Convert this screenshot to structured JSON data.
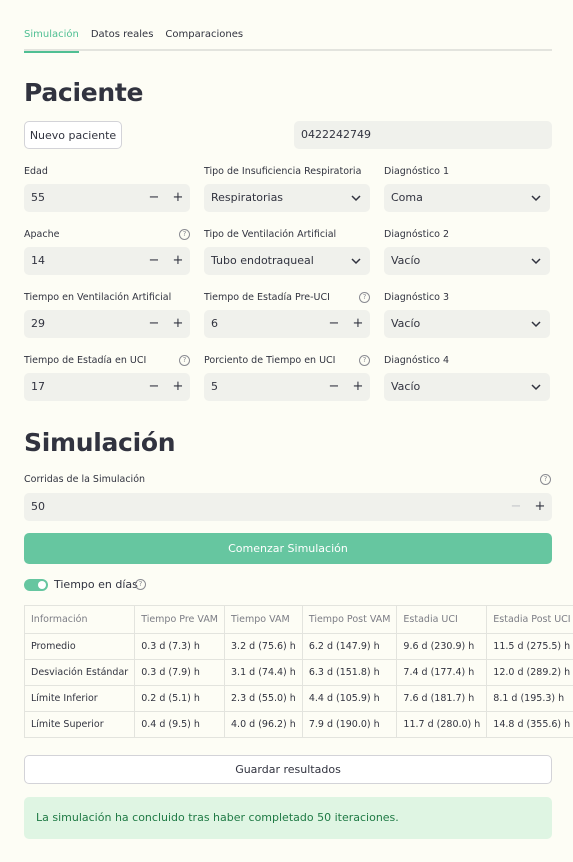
{
  "tabs": [
    "Simulación",
    "Datos reales",
    "Comparaciones"
  ],
  "paciente": {
    "title": "Paciente",
    "new_patient_label": "Nuevo paciente",
    "patient_id": "0422242749",
    "edad": {
      "label": "Edad",
      "value": "55"
    },
    "insuficiencia": {
      "label": "Tipo de Insuficiencia Respiratoria",
      "value": "Respiratorias"
    },
    "diag1": {
      "label": "Diagnóstico 1",
      "value": "Coma"
    },
    "apache": {
      "label": "Apache",
      "value": "14"
    },
    "ventilacion": {
      "label": "Tipo de Ventilación Artificial",
      "value": "Tubo endotraqueal"
    },
    "diag2": {
      "label": "Diagnóstico 2",
      "value": "Vacío"
    },
    "tiempo_va": {
      "label": "Tiempo en Ventilación Artificial",
      "value": "29"
    },
    "estadia_pre": {
      "label": "Tiempo de Estadía Pre-UCI",
      "value": "6"
    },
    "diag3": {
      "label": "Diagnóstico 3",
      "value": "Vacío"
    },
    "estadia_uci": {
      "label": "Tiempo de Estadía en UCI",
      "value": "17"
    },
    "porciento": {
      "label": "Porciento de Tiempo en UCI",
      "value": "5"
    },
    "diag4": {
      "label": "Diagnóstico 4",
      "value": "Vacío"
    }
  },
  "simulacion": {
    "title": "Simulación",
    "corridas_label": "Corridas de la Simulación",
    "corridas_value": "50",
    "start_label": "Comenzar Simulación",
    "toggle_label": "Tiempo en días",
    "toggle_on": true,
    "table": {
      "headers": [
        "Información",
        "Tiempo Pre VAM",
        "Tiempo VAM",
        "Tiempo Post VAM",
        "Estadia UCI",
        "Estadia Post UCI"
      ],
      "rows": [
        [
          "Promedio",
          "0.3 d (7.3) h",
          "3.2 d (75.6) h",
          "6.2 d (147.9) h",
          "9.6 d (230.9) h",
          "11.5 d (275.5) h"
        ],
        [
          "Desviación Estándar",
          "0.3 d (7.9) h",
          "3.1 d (74.4) h",
          "6.3 d (151.8) h",
          "7.4 d (177.4) h",
          "12.0 d (289.2) h"
        ],
        [
          "Límite Inferior",
          "0.2 d (5.1) h",
          "2.3 d (55.0) h",
          "4.4 d (105.9) h",
          "7.6 d (181.7) h",
          "8.1 d (195.3) h"
        ],
        [
          "Límite Superior",
          "0.4 d (9.5) h",
          "4.0 d (96.2) h",
          "7.9 d (190.0) h",
          "11.7 d (280.0) h",
          "14.8 d (355.6) h"
        ]
      ]
    },
    "save_label": "Guardar resultados",
    "success_message": "La simulación ha concluido tras haber completado 50 iteraciones."
  },
  "colors": {
    "accent": "#66c6a0",
    "success_bg": "#dff5e3",
    "success_text": "#1f7a45"
  }
}
